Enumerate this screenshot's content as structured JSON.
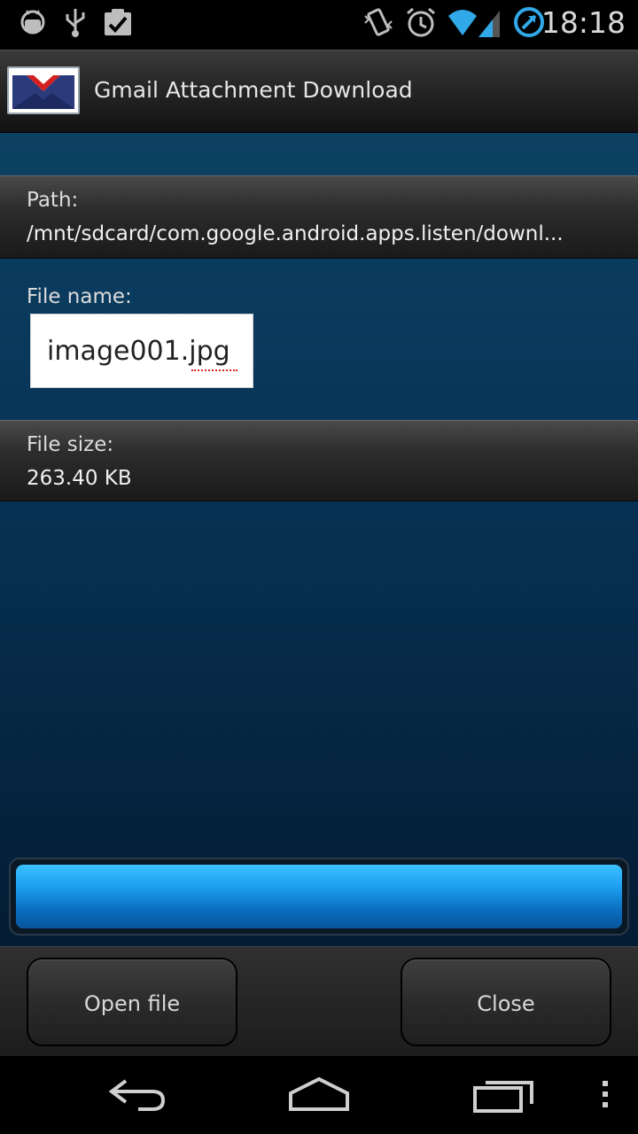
{
  "status_bar": {
    "time": "18:18",
    "icons": [
      "android-debug-icon",
      "usb-icon",
      "clipboard-check-icon",
      "vibrate-icon",
      "alarm-icon",
      "wifi-icon",
      "signal-icon",
      "sync-icon"
    ]
  },
  "app": {
    "title": "Gmail Attachment Download",
    "icon": "gmail-envelope-icon"
  },
  "path": {
    "label": "Path:",
    "value": "/mnt/sdcard/com.google.android.apps.listen/downl..."
  },
  "file_name": {
    "label": "File name:",
    "value": "image001.jpg"
  },
  "file_size": {
    "label": "File size:",
    "value": "263.40 KB"
  },
  "progress": {
    "fraction": 1.0,
    "color": "#1c9fef"
  },
  "buttons": {
    "open_label": "Open file",
    "close_label": "Close"
  },
  "nav_bar": {
    "icons": [
      "back-icon",
      "home-icon",
      "recent-apps-icon",
      "overflow-menu-icon"
    ]
  }
}
